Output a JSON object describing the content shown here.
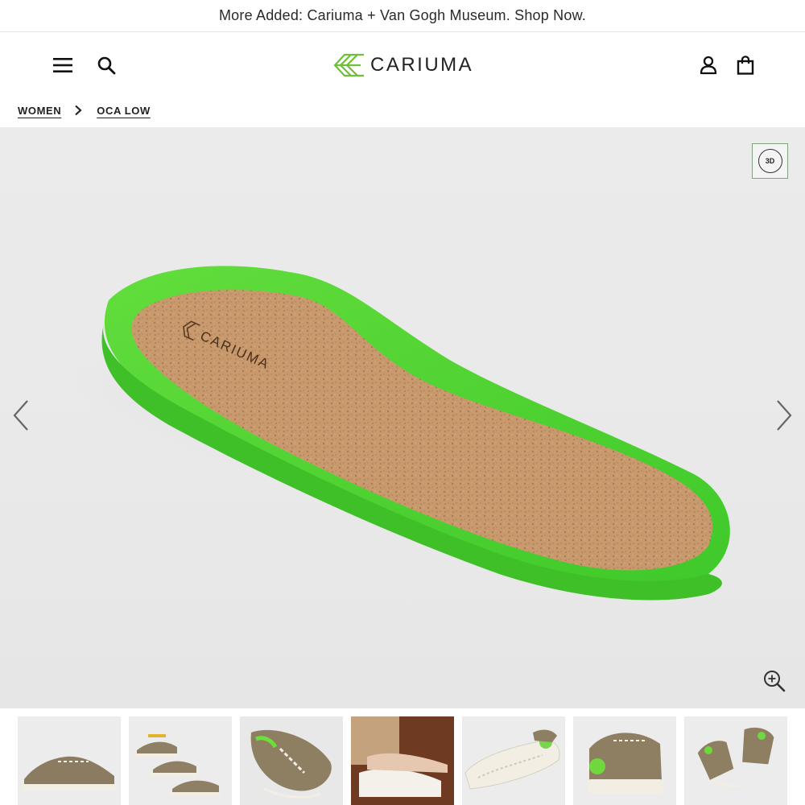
{
  "announcement": {
    "text": "More Added: Cariuma + Van Gogh Museum. Shop Now."
  },
  "header": {
    "brand": "CARIUMA",
    "brand_color": "#6fbf3a",
    "icons": [
      "menu-icon",
      "search-icon",
      "account-icon",
      "bag-icon"
    ]
  },
  "breadcrumb": {
    "items": [
      {
        "label": "WOMEN"
      },
      {
        "label": "OCA LOW"
      }
    ]
  },
  "gallery": {
    "main_image": "insole-cork-green",
    "insole_brand": "CARIUMA",
    "badge_3d": "3D",
    "accent_green": "#5fd63a",
    "cork_color": "#c89a6e"
  },
  "thumbnails": [
    {
      "name": "thumb-side-view"
    },
    {
      "name": "thumb-group-view"
    },
    {
      "name": "thumb-top-view"
    },
    {
      "name": "thumb-lifestyle-view"
    },
    {
      "name": "thumb-sole-view"
    },
    {
      "name": "thumb-heel-view"
    },
    {
      "name": "thumb-pair-view"
    }
  ]
}
